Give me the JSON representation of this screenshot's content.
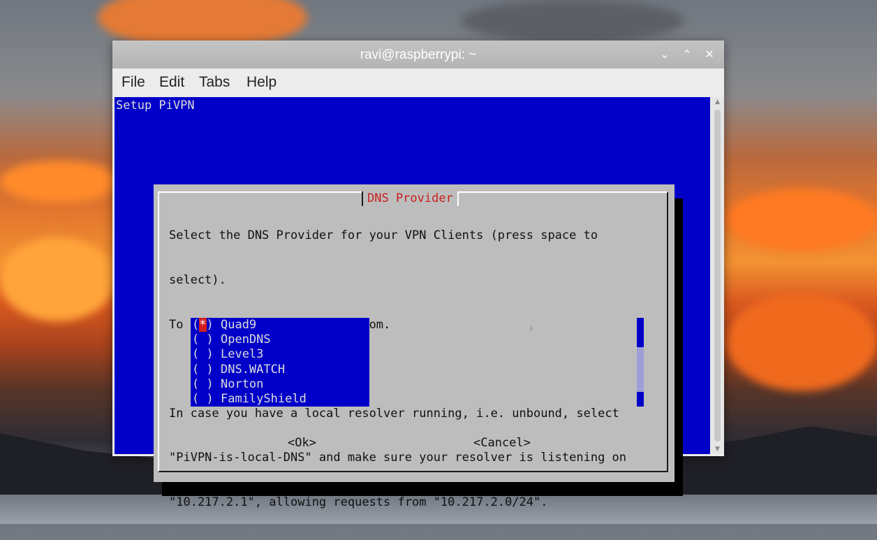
{
  "window": {
    "title": "ravi@raspberrypi: ~",
    "controls": {
      "minimize": "⌄",
      "maximize": "⌃",
      "close": "✕"
    }
  },
  "menu": {
    "file": "File",
    "edit": "Edit",
    "tabs": "Tabs",
    "help": "Help"
  },
  "terminal": {
    "heading": "Setup PiVPN"
  },
  "dialog": {
    "title": "DNS Provider",
    "lines": [
      "Select the DNS Provider for your VPN Clients (press space to",
      "select).",
      "To use your own, select Custom.",
      "",
      "In case you have a local resolver running, i.e. unbound, select",
      "\"PiVPN-is-local-DNS\" and make sure your resolver is listening on",
      "\"10.217.2.1\", allowing requests from \"10.217.2.0/24\"."
    ],
    "options": [
      {
        "label": "Quad9",
        "mark": "*",
        "selected": true
      },
      {
        "label": "OpenDNS",
        "mark": " ",
        "selected": false
      },
      {
        "label": "Level3",
        "mark": " ",
        "selected": false
      },
      {
        "label": "DNS.WATCH",
        "mark": " ",
        "selected": false
      },
      {
        "label": "Norton",
        "mark": " ",
        "selected": false
      },
      {
        "label": "FamilyShield",
        "mark": " ",
        "selected": false
      }
    ],
    "ok_label": "<Ok>",
    "cancel_label": "<Cancel>"
  },
  "colors": {
    "terminal_bg": "#0000c8",
    "dialog_bg": "#bdbdbd",
    "title_red": "#c81e1e",
    "selection_red": "#d21e1e"
  }
}
